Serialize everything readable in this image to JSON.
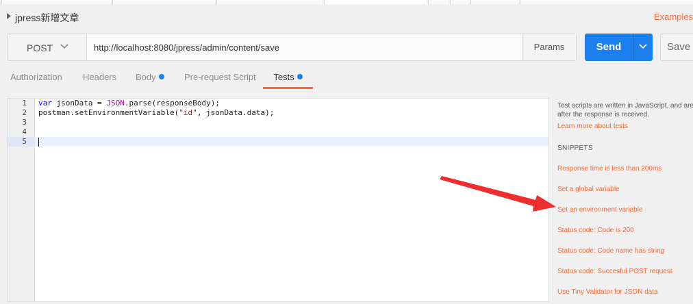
{
  "request": {
    "title": "jpress新增文章",
    "examples_label": "Examples"
  },
  "url_bar": {
    "method": "POST",
    "url": "http://localhost:8080/jpress/admin/content/save",
    "params_label": "Params"
  },
  "actions": {
    "send_label": "Send",
    "save_label": "Save"
  },
  "tabs": [
    {
      "label": "Authorization",
      "active": false,
      "dot": false
    },
    {
      "label": "Headers",
      "active": false,
      "dot": false
    },
    {
      "label": "Body",
      "active": false,
      "dot": true
    },
    {
      "label": "Pre-request Script",
      "active": false,
      "dot": false
    },
    {
      "label": "Tests",
      "active": true,
      "dot": true
    }
  ],
  "editor": {
    "line_numbers": [
      "1",
      "2",
      "3",
      "4",
      "5"
    ],
    "lines": [
      "var jsonData = JSON.parse(responseBody);",
      "postman.setEnvironmentVariable(\"id\", jsonData.data);",
      "",
      "",
      ""
    ],
    "active_line": 5
  },
  "help": {
    "description": "Test scripts are written in JavaScript, and are run after the response is received.",
    "learn_more": "Learn more about tests",
    "snippets_heading": "SNIPPETS",
    "snippets": [
      "Response time is less than 200ms",
      "Set a global variable",
      "Set an environment variable",
      "Status code: Code is 200",
      "Status code: Code name has string",
      "Status code: Succesful POST request",
      "Use Tiny Validator for JSON data"
    ]
  },
  "colors": {
    "accent": "#f26b3a",
    "primary_button": "#1b7ff0",
    "annotation_arrow": "#ee2e2e"
  }
}
